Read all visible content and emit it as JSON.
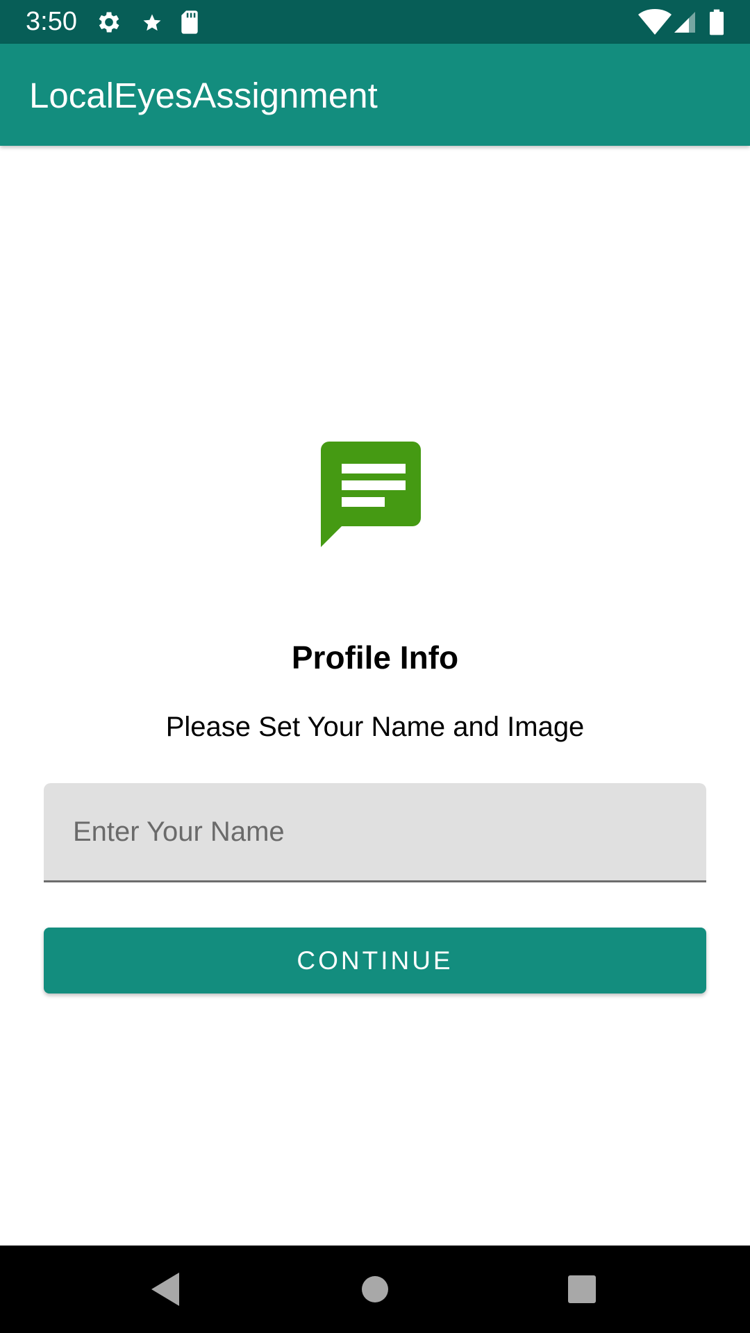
{
  "status_bar": {
    "time": "3:50",
    "icons": [
      "settings-icon",
      "star-icon",
      "sd-card-icon",
      "wifi-icon",
      "signal-icon",
      "battery-icon"
    ]
  },
  "app_bar": {
    "title": "LocalEyesAssignment",
    "color": "#138d7e"
  },
  "profile": {
    "logo_icon": "message-bubble-icon",
    "logo_color": "#459a13",
    "title": "Profile Info",
    "subtitle": "Please Set Your Name and Image",
    "name_input": {
      "placeholder": "Enter Your Name",
      "value": ""
    },
    "continue_label": "CONTINUE"
  },
  "nav_bar": {
    "buttons": [
      "back-icon",
      "home-icon",
      "recents-icon"
    ]
  }
}
